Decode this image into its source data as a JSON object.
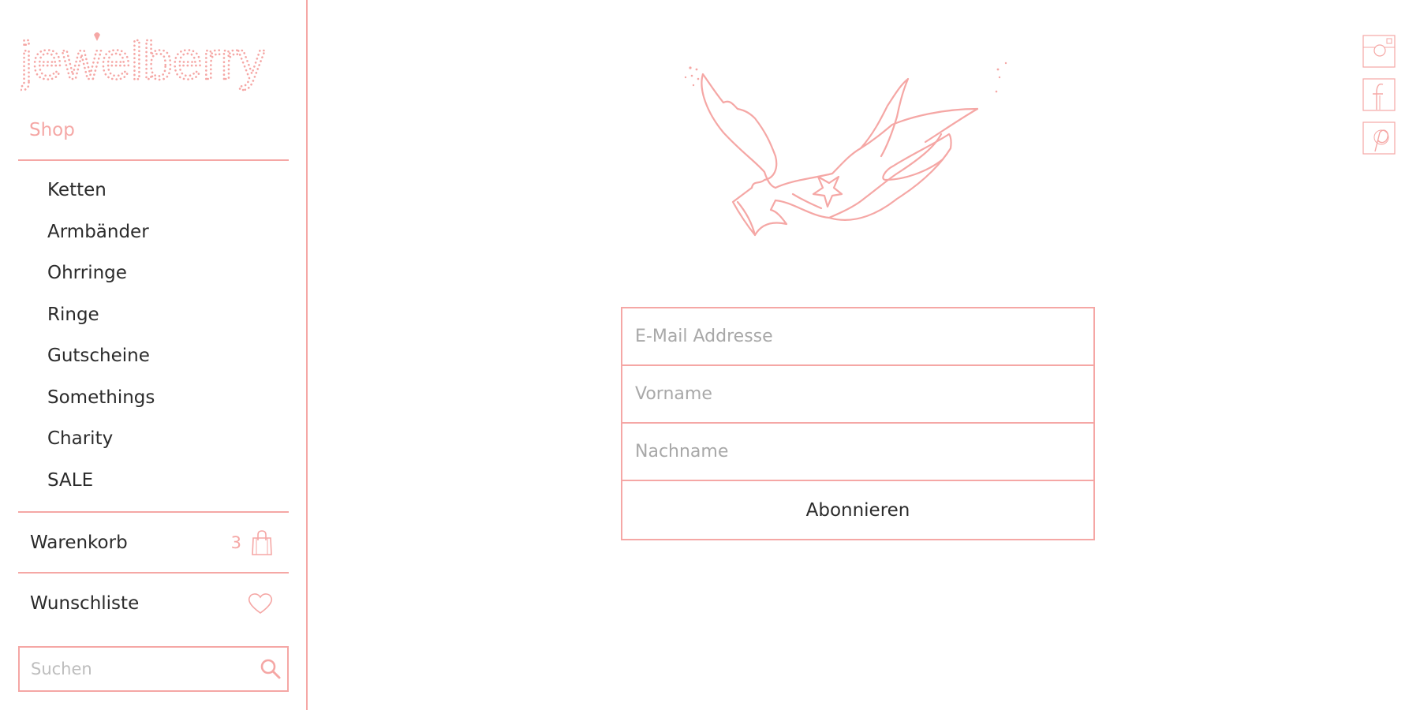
{
  "brand": {
    "logo_text": "jewelberry"
  },
  "sidebar": {
    "shop_label": "Shop",
    "nav_items": [
      {
        "label": "Ketten"
      },
      {
        "label": "Armbänder"
      },
      {
        "label": "Ohrringe"
      },
      {
        "label": "Ringe"
      },
      {
        "label": "Gutscheine"
      },
      {
        "label": "Somethings"
      },
      {
        "label": "Charity"
      },
      {
        "label": "SALE"
      }
    ],
    "cart": {
      "label": "Warenkorb",
      "count": "3",
      "icon": "shopping-bag-icon"
    },
    "wishlist": {
      "label": "Wunschliste",
      "icon": "heart-icon"
    },
    "search": {
      "placeholder": "Suchen",
      "value": "",
      "icon": "search-icon"
    }
  },
  "newsletter": {
    "illustration": "swallow-bird-illustration",
    "email_placeholder": "E-Mail Addresse",
    "firstname_placeholder": "Vorname",
    "lastname_placeholder": "Nachname",
    "submit_label": "Abonnieren"
  },
  "social": [
    {
      "name": "instagram",
      "icon": "instagram-icon"
    },
    {
      "name": "facebook",
      "icon": "facebook-icon"
    },
    {
      "name": "pinterest",
      "icon": "pinterest-icon"
    }
  ],
  "colors": {
    "accent": "#f5a7a5",
    "text": "#2b2b2b",
    "placeholder": "#a8a8a8"
  }
}
